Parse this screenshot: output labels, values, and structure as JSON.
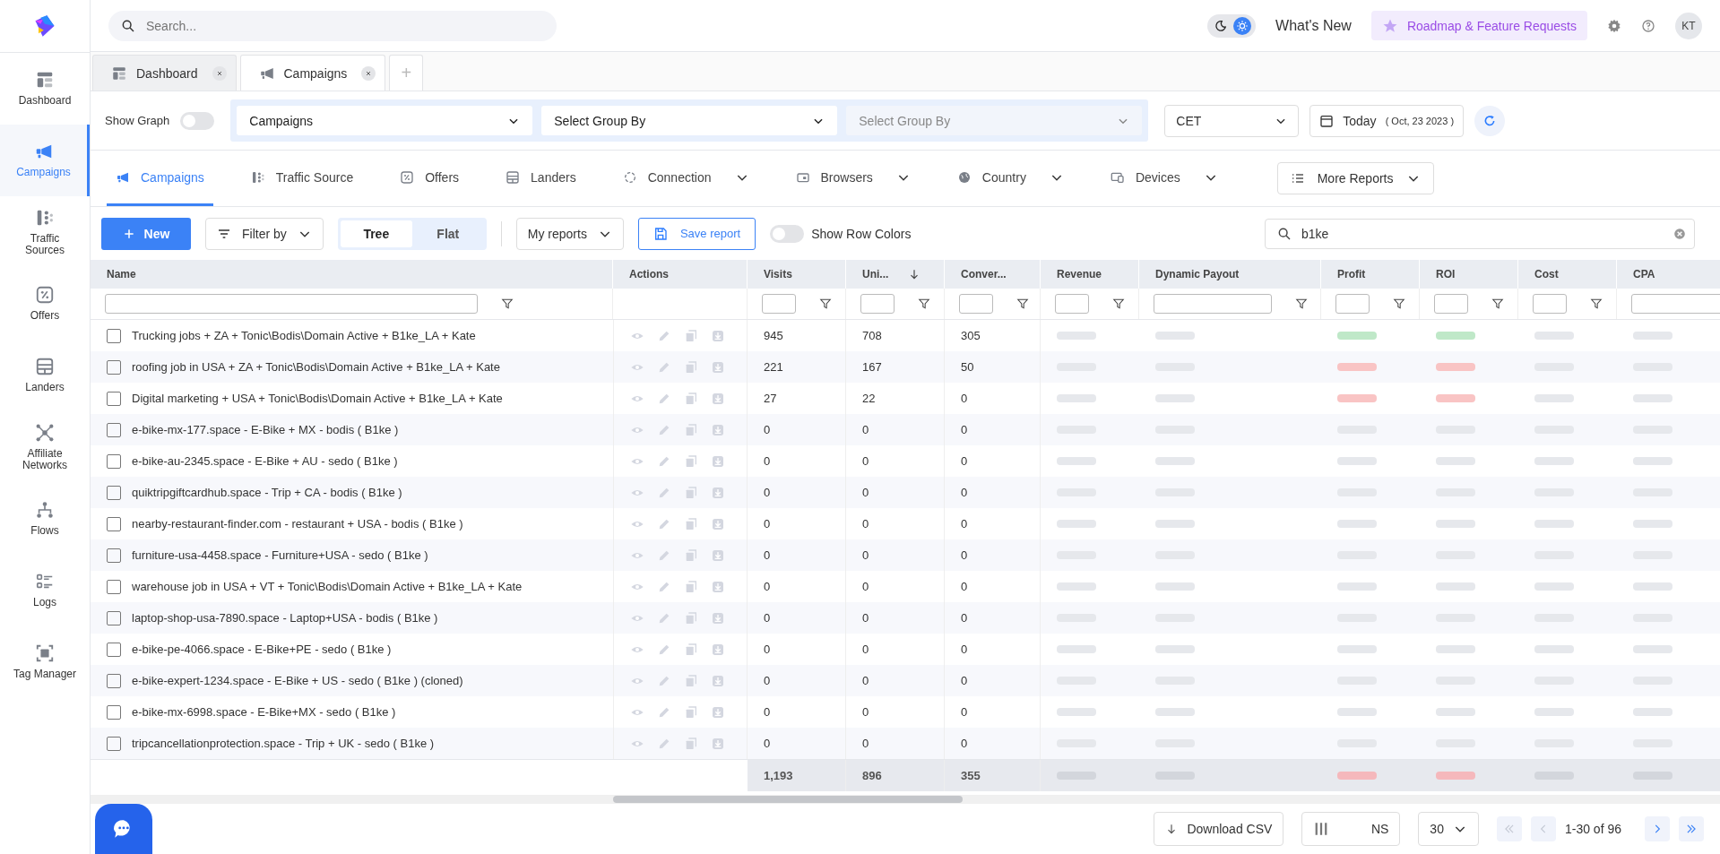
{
  "sidebar": {
    "items": [
      {
        "label": "Dashboard",
        "selected": false
      },
      {
        "label": "Campaigns",
        "selected": true
      },
      {
        "label": "Traffic Sources",
        "selected": false
      },
      {
        "label": "Offers",
        "selected": false
      },
      {
        "label": "Landers",
        "selected": false
      },
      {
        "label": "Affiliate Networks",
        "selected": false
      },
      {
        "label": "Flows",
        "selected": false
      },
      {
        "label": "Logs",
        "selected": false
      },
      {
        "label": "Tag Manager",
        "selected": false
      }
    ]
  },
  "topbar": {
    "search": {
      "placeholder": "Search..."
    },
    "theme": [
      {
        "selected": false
      },
      {
        "selected": true
      }
    ],
    "whats_new": "What's New",
    "roadmap": "Roadmap & Feature Requests",
    "avatar": "KT"
  },
  "page_tabs": {
    "tabs": [
      {
        "label": "Dashboard",
        "selected": false
      },
      {
        "label": "Campaigns",
        "selected": true
      }
    ],
    "add": "+"
  },
  "filter_bar": {
    "show_graph": {
      "label": "Show Graph",
      "on": false
    },
    "group_by": [
      {
        "value": "Campaigns",
        "disabled": false
      },
      {
        "value": "Select Group By",
        "disabled": false
      },
      {
        "placeholder": "Select Group By",
        "disabled": true
      }
    ],
    "timezone": "CET",
    "date": {
      "label": "Today",
      "detail": "( Oct, 23 2023 )"
    }
  },
  "report_tabs": {
    "tabs": [
      {
        "label": "Campaigns",
        "selected": true,
        "dropdown": false
      },
      {
        "label": "Traffic Source",
        "selected": false,
        "dropdown": false
      },
      {
        "label": "Offers",
        "selected": false,
        "dropdown": false
      },
      {
        "label": "Landers",
        "selected": false,
        "dropdown": false
      },
      {
        "label": "Connection",
        "selected": false,
        "dropdown": true
      },
      {
        "label": "Browsers",
        "selected": false,
        "dropdown": true
      },
      {
        "label": "Country",
        "selected": false,
        "dropdown": true
      },
      {
        "label": "Devices",
        "selected": false,
        "dropdown": true
      }
    ],
    "more": "More Reports"
  },
  "toolbar": {
    "new": "New",
    "filter": "Filter by",
    "view": [
      {
        "label": "Tree",
        "selected": true
      },
      {
        "label": "Flat",
        "selected": false
      }
    ],
    "my_reports": "My reports",
    "save_report": "Save report",
    "row_colors": {
      "label": "Show Row Colors",
      "on": false
    },
    "search": {
      "value": "b1ke"
    }
  },
  "table": {
    "columns": [
      {
        "label": "Name",
        "kind": "name",
        "sorted": false
      },
      {
        "label": "Actions",
        "kind": "actions",
        "sorted": false
      },
      {
        "label": "Visits",
        "kind": "num",
        "sorted": false
      },
      {
        "label": "Uni...",
        "kind": "num",
        "sorted": true
      },
      {
        "label": "Conver...",
        "kind": "num",
        "sorted": false
      },
      {
        "label": "Revenue",
        "kind": "num",
        "sorted": false
      },
      {
        "label": "Dynamic Payout",
        "kind": "wide",
        "sorted": false
      },
      {
        "label": "Profit",
        "kind": "num",
        "sorted": false
      },
      {
        "label": "ROI",
        "kind": "num",
        "sorted": false
      },
      {
        "label": "Cost",
        "kind": "num",
        "sorted": false
      },
      {
        "label": "CPA",
        "kind": "wide",
        "sorted": false
      }
    ],
    "rows": [
      {
        "name": "Trucking jobs + ZA + Tonic\\Bodis\\Domain Active + B1ke_LA + Kate",
        "checked": false,
        "visits": "945",
        "unique": "708",
        "conversions": "305",
        "color": "#bfe8c8"
      },
      {
        "name": "roofing job in USA + ZA + Tonic\\Bodis\\Domain Active + B1ke_LA + Kate",
        "checked": false,
        "visits": "221",
        "unique": "167",
        "conversions": "50",
        "color": "#f9c4c4"
      },
      {
        "name": "Digital marketing + USA + Tonic\\Bodis\\Domain Active + B1ke_LA + Kate",
        "checked": false,
        "visits": "27",
        "unique": "22",
        "conversions": "0",
        "color": "#f9c4c4"
      },
      {
        "name": "e-bike-mx-177.space - E-Bike + MX - bodis ( B1ke )",
        "checked": false,
        "visits": "0",
        "unique": "0",
        "conversions": "0",
        "color": "#e6e8ec"
      },
      {
        "name": "e-bike-au-2345.space - E-Bike + AU - sedo ( B1ke )",
        "checked": false,
        "visits": "0",
        "unique": "0",
        "conversions": "0",
        "color": "#e6e8ec"
      },
      {
        "name": "quiktripgiftcardhub.space - Trip + CA - bodis ( B1ke )",
        "checked": false,
        "visits": "0",
        "unique": "0",
        "conversions": "0",
        "color": "#e6e8ec"
      },
      {
        "name": "nearby-restaurant-finder.com - restaurant + USA - bodis ( B1ke )",
        "checked": false,
        "visits": "0",
        "unique": "0",
        "conversions": "0",
        "color": "#e6e8ec"
      },
      {
        "name": "furniture-usa-4458.space - Furniture+USA - sedo ( B1ke )",
        "checked": false,
        "visits": "0",
        "unique": "0",
        "conversions": "0",
        "color": "#e6e8ec"
      },
      {
        "name": "warehouse job in USA + VT + Tonic\\Bodis\\Domain Active + B1ke_LA + Kate",
        "checked": false,
        "visits": "0",
        "unique": "0",
        "conversions": "0",
        "color": "#e6e8ec"
      },
      {
        "name": "laptop-shop-usa-7890.space - Laptop+USA - bodis ( B1ke )",
        "checked": false,
        "visits": "0",
        "unique": "0",
        "conversions": "0",
        "color": "#e6e8ec"
      },
      {
        "name": "e-bike-pe-4066.space - E-Bike+PE - sedo ( B1ke )",
        "checked": false,
        "visits": "0",
        "unique": "0",
        "conversions": "0",
        "color": "#e6e8ec"
      },
      {
        "name": "e-bike-expert-1234.space - E-Bike + US - sedo ( B1ke ) (cloned)",
        "checked": false,
        "visits": "0",
        "unique": "0",
        "conversions": "0",
        "color": "#e6e8ec"
      },
      {
        "name": "e-bike-mx-6998.space - E-Bike+MX - sedo ( B1ke )",
        "checked": false,
        "visits": "0",
        "unique": "0",
        "conversions": "0",
        "color": "#e6e8ec"
      },
      {
        "name": "tripcancellationprotection.space - Trip + UK - sedo ( B1ke )",
        "checked": false,
        "visits": "0",
        "unique": "0",
        "conversions": "0",
        "color": "#e6e8ec"
      }
    ],
    "totals": {
      "visits": "1,193",
      "unique": "896",
      "conversions": "355",
      "color": "#f5b8bc"
    }
  },
  "footer": {
    "download": "Download CSV",
    "columns": "NS",
    "page_size": "30",
    "range": "1-30 of 96",
    "first": {
      "disabled": true
    },
    "prev": {
      "disabled": true
    },
    "next": {
      "disabled": false
    },
    "last": {
      "disabled": false
    }
  }
}
